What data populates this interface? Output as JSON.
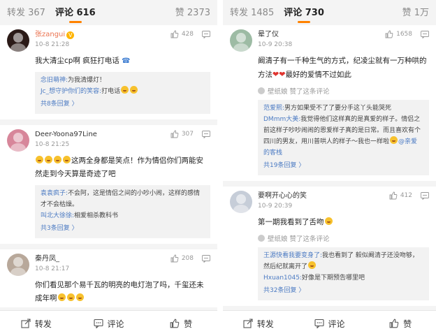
{
  "left": {
    "tabs": {
      "repost": "转发 367",
      "comment": "评论 616",
      "likes": "赞 2373"
    },
    "comments": [
      {
        "user": "张zangui",
        "time": "10-8 21:28",
        "likes": "428",
        "text": "我大清尘cp啊 疯狂打电话",
        "replies": [
          {
            "user": "念旧萌神:",
            "text": "为我清爆灯！"
          },
          {
            "user": "Jc_想守护你们的笑容:",
            "text": "打电话"
          }
        ],
        "more": "共8条回复 〉"
      },
      {
        "user": "Deer-Yoona97Line",
        "time": "10-8 21:25",
        "likes": "307",
        "text": "这两全身都是笑点！作为情侣你们两能安然走到今天算是奇迹了吧",
        "replies": [
          {
            "user": "袁袁疯子:",
            "text": "不会阿，这是情侣之间的小吵小闹，这样的感情才不会枯燥。"
          },
          {
            "user": "叫北大徐徐:",
            "text": "相爱相杀教科书"
          }
        ],
        "more": "共3条回复 〉"
      },
      {
        "user": "秦丹凤_",
        "time": "10-8 21:17",
        "likes": "208",
        "text": "你们看见那个易千瓦的明亮的电灯泡了吗，千玺还未成年啊"
      }
    ],
    "bottom": {
      "repost": "转发",
      "comment": "评论",
      "like": "赞"
    }
  },
  "right": {
    "tabs": {
      "repost": "转发 1485",
      "comment": "评论 730",
      "likes": "赞 1万"
    },
    "comments": [
      {
        "user": "晕了仪",
        "time": "10-9 20:38",
        "likes": "1658",
        "text_a": "阚清子有一千种生气的方式，纪凌尘就有一万种哄的方法",
        "text_b": "最好的爱情不过如此",
        "fan_note": "壁纸娘 赞了这条评论",
        "replies": [
          {
            "user": "范爱熙:",
            "text": "男方如果受不了了要分手这丫头能哭死"
          },
          {
            "user": "DMmm大美:",
            "text": "我觉得他们这样真的是真爱的样子。情侣之前这样子吵吵闹闹的恩爱样子真的是日常。而且喜欢有个四川的男友，用川普哄人的样子～我也一样啦"
          },
          {
            "user": "",
            "text": "@亲爱的客栈"
          }
        ],
        "more": "共19条回复 〉"
      },
      {
        "user": "要啊开心心的笑",
        "time": "10-9 20:39",
        "likes": "412",
        "text": "第一期我看到了舌吻",
        "fan_note": "壁纸娘 赞了这条评论",
        "replies": [
          {
            "user": "王源快看我要变身了:",
            "text": "我也看到了 毅似阚清子还没吻够，然后纪就离开了"
          },
          {
            "user": "Hxuan1045:",
            "text": "好像是下期预告哪里吧"
          }
        ],
        "more": "共32条回复 〉"
      }
    ],
    "bottom": {
      "repost": "转发",
      "comment": "评论",
      "like": "赞"
    }
  },
  "colors": {
    "accent": "#ff8200",
    "link": "#4c7bc3",
    "username_vip": "#eb7350"
  },
  "icons": [
    "thumb-up-icon",
    "reply-icon",
    "share-icon",
    "comment-icon",
    "chevron-right-icon"
  ]
}
